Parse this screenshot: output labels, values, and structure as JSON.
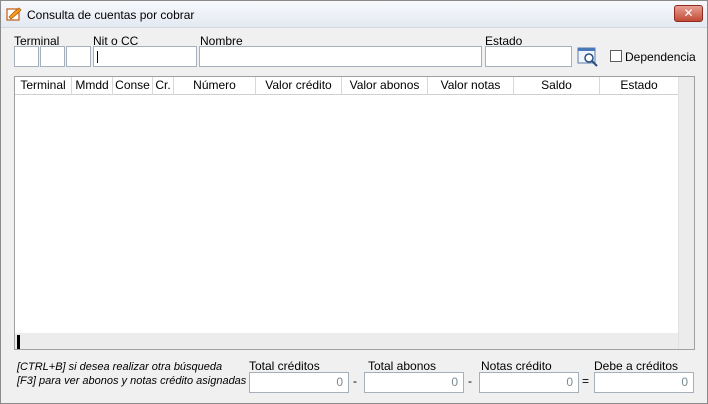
{
  "window": {
    "title": "Consulta de cuentas por cobrar",
    "close_label": "✕"
  },
  "filters": {
    "terminal_label": "Terminal",
    "nit_label": "Nit o CC",
    "nombre_label": "Nombre",
    "estado_label": "Estado",
    "dependencia_label": "Dependencia",
    "terminal_values": [
      "",
      "",
      ""
    ],
    "nit_value": "",
    "nombre_value": "",
    "estado_value": "",
    "dependencia_checked": false
  },
  "grid": {
    "columns": [
      "Terminal",
      "Mmdd",
      "Conse",
      "Cr.",
      "Número",
      "Valor crédito",
      "Valor abonos",
      "Valor notas",
      "Saldo",
      "Estado"
    ],
    "rows": []
  },
  "footer": {
    "hint_1": "[CTRL+B] si desea realizar otra búsqueda",
    "hint_2": "[F3] para ver abonos y notas crédito asignadas",
    "total_creditos_label": "Total créditos",
    "total_abonos_label": "Total abonos",
    "notas_credito_label": "Notas crédito",
    "debe_creditos_label": "Debe a créditos",
    "total_creditos": "0",
    "total_abonos": "0",
    "notas_credito": "0",
    "debe_creditos": "0",
    "op_minus_1": "-",
    "op_minus_2": "-",
    "op_equals": "="
  }
}
